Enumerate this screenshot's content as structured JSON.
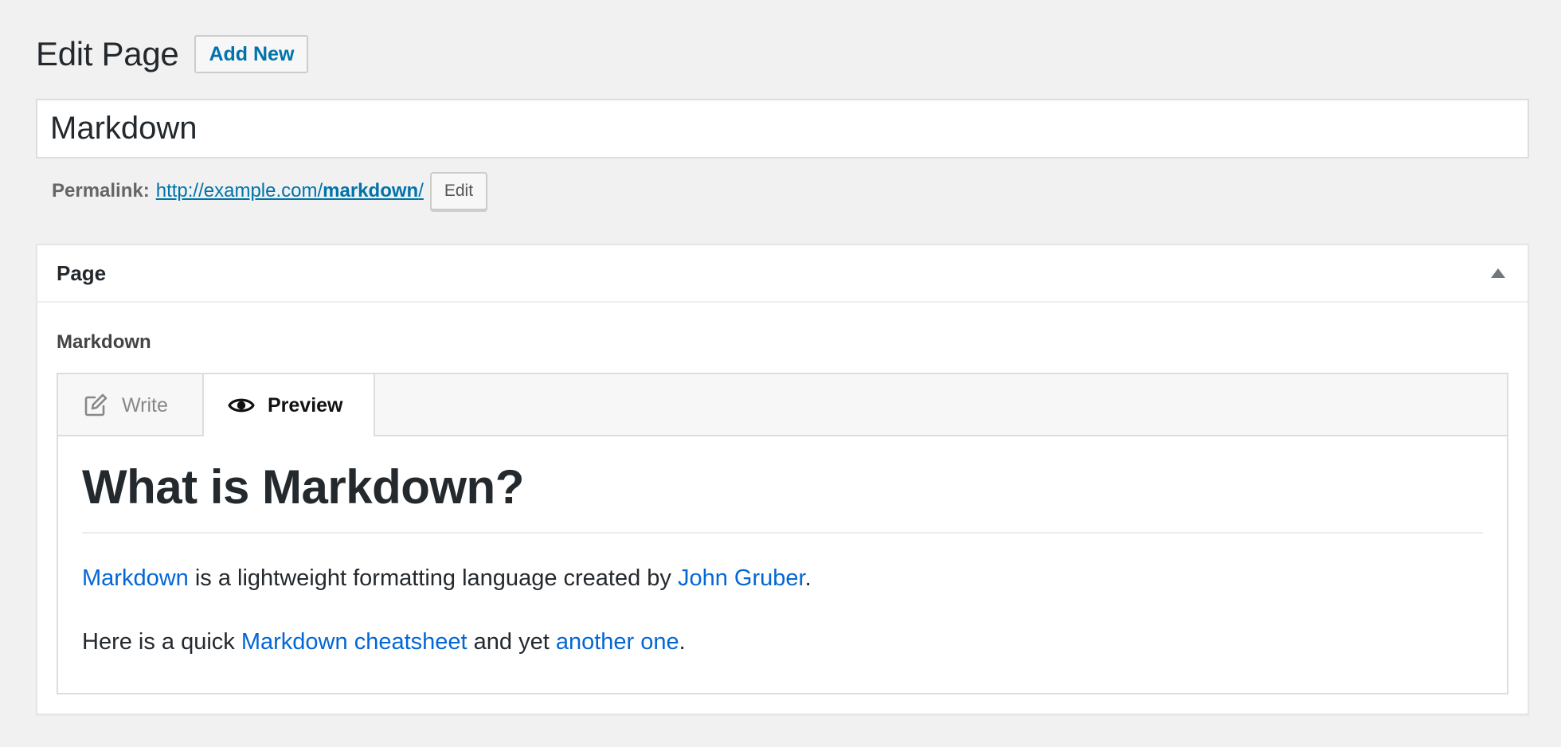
{
  "header": {
    "title": "Edit Page",
    "add_new_label": "Add New"
  },
  "title_field": {
    "value": "Markdown"
  },
  "permalink": {
    "label": "Permalink:",
    "base": "http://example.com/",
    "slug": "markdown",
    "trailing": "/",
    "edit_label": "Edit"
  },
  "postbox": {
    "title": "Page",
    "toggle_icon": "triangle-up-icon"
  },
  "markdown_field": {
    "label": "Markdown",
    "tabs": [
      {
        "label": "Write",
        "icon": "edit-icon",
        "active": false
      },
      {
        "label": "Preview",
        "icon": "eye-icon",
        "active": true
      }
    ],
    "preview": {
      "heading": "What is Markdown?",
      "p1": {
        "link1": "Markdown",
        "text1": " is a lightweight formatting language created by ",
        "link2": "John Gruber",
        "text2": "."
      },
      "p2": {
        "text1": "Here is a quick ",
        "link1": "Markdown cheatsheet",
        "text2": " and yet ",
        "link2": "another one",
        "text3": "."
      }
    }
  },
  "colors": {
    "background": "#f1f1f1",
    "wp_link": "#0073aa",
    "preview_link": "#0366d6",
    "text": "#23282d"
  }
}
